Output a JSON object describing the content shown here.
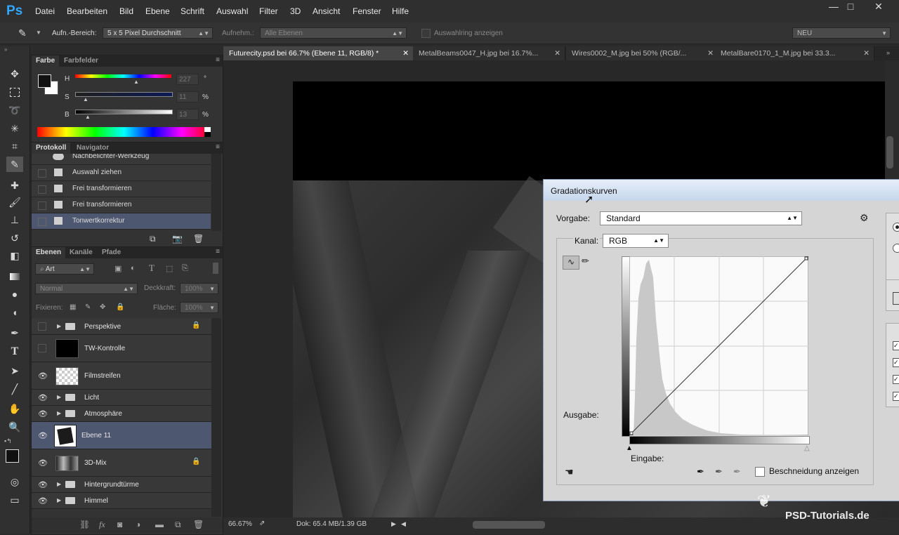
{
  "app": {
    "logo": "Ps",
    "menu": [
      "Datei",
      "Bearbeiten",
      "Bild",
      "Ebene",
      "Schrift",
      "Auswahl",
      "Filter",
      "3D",
      "Ansicht",
      "Fenster",
      "Hilfe"
    ]
  },
  "window_controls": {
    "minimize": "—",
    "maximize": "□",
    "close": "✕"
  },
  "options_bar": {
    "sample_area_label": "Aufn.-Bereich:",
    "sample_area_value": "5 x 5 Pixel Durchschnitt",
    "sample_label": "Aufnehm.:",
    "sample_value": "Alle Ebenen",
    "show_ring_label": "Auswahlring anzeigen",
    "workspace": "NEU"
  },
  "color_panel": {
    "tabs": [
      "Farbe",
      "Farbfelder"
    ],
    "h_label": "H",
    "h_value": "227",
    "h_unit": "°",
    "s_label": "S",
    "s_value": "11",
    "s_unit": "%",
    "b_label": "B",
    "b_value": "13",
    "b_unit": "%"
  },
  "history_panel": {
    "tabs": [
      "Protokoll",
      "Navigator"
    ],
    "items": [
      "Nachbelichter-Werkzeug",
      "Auswahl ziehen",
      "Frei transformieren",
      "Frei transformieren",
      "Tonwertkorrektur"
    ]
  },
  "layers_panel": {
    "tabs": [
      "Ebenen",
      "Kanäle",
      "Pfade"
    ],
    "filter_label": "Art",
    "blend_mode": "Normal",
    "opacity_label": "Deckkraft:",
    "opacity_value": "100%",
    "lock_label": "Fixieren:",
    "fill_label": "Fläche:",
    "fill_value": "100%",
    "layers": [
      "Perspektive",
      "TW-Kontrolle",
      "Filmstreifen",
      "Licht",
      "Atmosphäre",
      "Ebene 11",
      "3D-Mix",
      "Hintergrundtürme",
      "Himmel"
    ]
  },
  "doc_tabs": [
    "Futurecity.psd bei 66.7% (Ebene 11, RGB/8) *",
    "MetalBeams0047_H.jpg bei 16.7%...",
    "Wires0002_M.jpg bei 50% (RGB/...",
    "MetalBare0170_1_M.jpg bei 33.3..."
  ],
  "status_bar": {
    "zoom": "66.67%",
    "doc_info": "Dok: 65.4 MB/1.39 GB"
  },
  "curves_dialog": {
    "title": "Gradationskurven",
    "preset_label": "Vorgabe:",
    "preset_value": "Standard",
    "channel_label": "Kanal:",
    "channel_value": "RGB",
    "output_label": "Ausgabe:",
    "input_label": "Eingabe:",
    "clip_label": "Beschneidung anzeigen"
  },
  "watermark": "PSD-Tutorials.de"
}
